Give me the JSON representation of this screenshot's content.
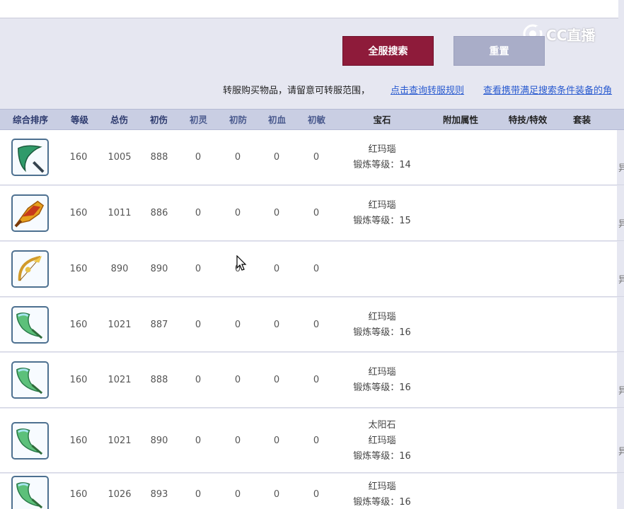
{
  "watermark": {
    "text": "CC直播"
  },
  "buttons": {
    "search_label": "全服搜索",
    "reset_label": "重置"
  },
  "notice": {
    "text": "转服购买物品，请留意可转服范围，",
    "link_rules": "点击查询转服规则",
    "link_equip": "查看携带满足搜索条件装备的角"
  },
  "table": {
    "headers": [
      "综合排序",
      "等级",
      "总伤",
      "初伤",
      "初灵",
      "初防",
      "初血",
      "初敏",
      "宝石",
      "附加属性",
      "特技/特效",
      "套装"
    ],
    "rows": [
      {
        "icon": "green-blade-icon",
        "level": "160",
        "total": "1005",
        "base": "888",
        "ling": "0",
        "def": "0",
        "hp": "0",
        "agi": "0",
        "gems": [
          "红玛瑙",
          "锻炼等级：14"
        ],
        "trunc": "异"
      },
      {
        "icon": "golden-dragon-blade-icon",
        "level": "160",
        "total": "1011",
        "base": "886",
        "ling": "0",
        "def": "0",
        "hp": "0",
        "agi": "0",
        "gems": [
          "红玛瑙",
          "锻炼等级：15"
        ],
        "trunc": "异"
      },
      {
        "icon": "golden-bow-icon",
        "level": "160",
        "total": "890",
        "base": "890",
        "ling": "0",
        "def": "0",
        "hp": "0",
        "agi": "0",
        "gems": [],
        "trunc": "异"
      },
      {
        "icon": "jade-blade-icon",
        "level": "160",
        "total": "1021",
        "base": "887",
        "ling": "0",
        "def": "0",
        "hp": "0",
        "agi": "0",
        "gems": [
          "红玛瑙",
          "锻炼等级：16"
        ],
        "trunc": ""
      },
      {
        "icon": "jade-blade-icon",
        "level": "160",
        "total": "1021",
        "base": "888",
        "ling": "0",
        "def": "0",
        "hp": "0",
        "agi": "0",
        "gems": [
          "红玛瑙",
          "锻炼等级：16"
        ],
        "trunc": "异"
      },
      {
        "icon": "jade-blade-icon",
        "level": "160",
        "total": "1021",
        "base": "890",
        "ling": "0",
        "def": "0",
        "hp": "0",
        "agi": "0",
        "gems": [
          "太阳石",
          "红玛瑙",
          "锻炼等级：16"
        ],
        "trunc": "异"
      },
      {
        "icon": "jade-blade-icon",
        "level": "160",
        "total": "1026",
        "base": "893",
        "ling": "0",
        "def": "0",
        "hp": "0",
        "agi": "0",
        "gems": [
          "红玛瑙",
          "锻炼等级：16"
        ],
        "trunc": ""
      }
    ]
  },
  "colors": {
    "accent": "#8e1b3a",
    "reset": "#a9adc8",
    "header_bg": "#c9cee3",
    "link": "#2a5bd0"
  }
}
